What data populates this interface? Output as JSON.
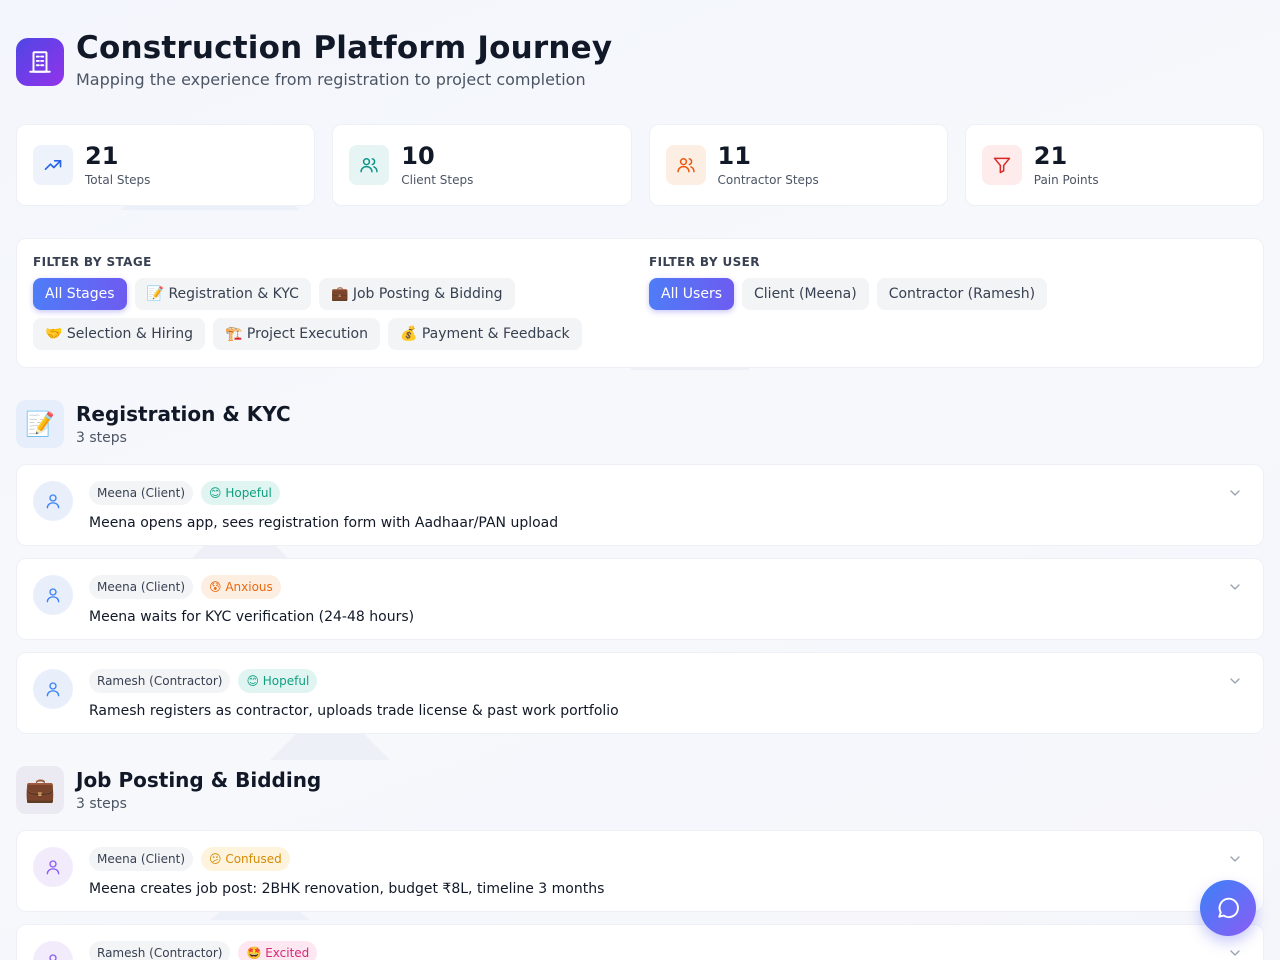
{
  "header": {
    "title": "Construction Platform Journey",
    "subtitle": "Mapping the experience from registration to project completion",
    "logo_icon": "building-icon"
  },
  "stats": [
    {
      "value": "21",
      "label": "Total Steps",
      "icon": "trending-up-icon",
      "color": "#2563eb",
      "bg": "#eef2fb"
    },
    {
      "value": "10",
      "label": "Client Steps",
      "icon": "users-icon",
      "color": "#0d9488",
      "bg": "#e6f4f3"
    },
    {
      "value": "11",
      "label": "Contractor Steps",
      "icon": "users-icon",
      "color": "#ea580c",
      "bg": "#fdeee4"
    },
    {
      "value": "21",
      "label": "Pain Points",
      "icon": "filter-icon",
      "color": "#dc2626",
      "bg": "#fdeceb"
    }
  ],
  "filters": {
    "stage_title": "FILTER BY STAGE",
    "stages": [
      "All Stages",
      "📝 Registration & KYC",
      "💼 Job Posting & Bidding",
      "🤝 Selection & Hiring",
      "🏗️ Project Execution",
      "💰 Payment & Feedback"
    ],
    "user_title": "FILTER BY USER",
    "users": [
      "All Users",
      "Client (Meena)",
      "Contractor (Ramesh)"
    ]
  },
  "sections": [
    {
      "emoji": "📝",
      "title": "Registration & KYC",
      "count": "3 steps",
      "steps": [
        {
          "user": "Meena (Client)",
          "mood": "😊 Hopeful",
          "text": "Meena opens app, sees registration form with Aadhaar/PAN upload"
        },
        {
          "user": "Meena (Client)",
          "mood": "😰 Anxious",
          "text": "Meena waits for KYC verification (24-48 hours)"
        },
        {
          "user": "Ramesh (Contractor)",
          "mood": "😊 Hopeful",
          "text": "Ramesh registers as contractor, uploads trade license & past work portfolio"
        }
      ]
    },
    {
      "emoji": "💼",
      "title": "Job Posting & Bidding",
      "count": "3 steps",
      "steps": [
        {
          "user": "Meena (Client)",
          "mood": "😕 Confused",
          "text": "Meena creates job post: 2BHK renovation, budget ₹8L, timeline 3 months"
        },
        {
          "user": "Ramesh (Contractor)",
          "mood": "🤩 Excited",
          "text": ""
        }
      ]
    }
  ],
  "colors": {
    "accent": "#4f46e5",
    "hopeful_bg": "#e0f5f1",
    "hopeful_fg": "#0f9f80",
    "anxious_bg": "#fdeee2",
    "anxious_fg": "#ea6a10",
    "confused_bg": "#fef3dc",
    "confused_fg": "#d48c06",
    "excited_bg": "#fde7f1",
    "excited_fg": "#db2777"
  },
  "chat_icon": "chat-bubble-icon"
}
